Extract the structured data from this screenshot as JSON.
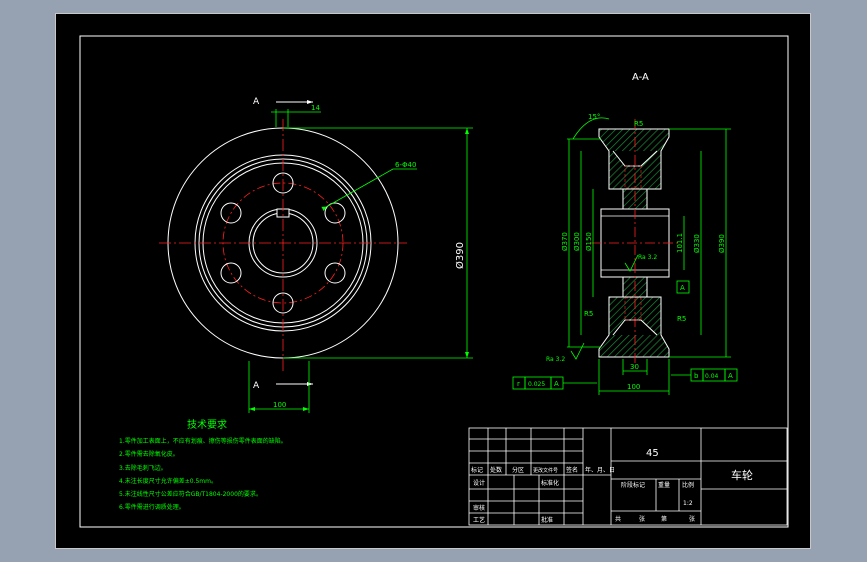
{
  "colors": {
    "background": "#96a1b1",
    "sheet": "#000000",
    "outline": "#ffffff",
    "dimension": "#00ff00",
    "centerline": "#ff2020",
    "hatch": "#1a8a3a"
  },
  "front_view": {
    "section_mark_top": "A",
    "section_mark_bottom": "A",
    "top_dim": "14",
    "hole_callout": "6-Φ40",
    "diameter_dim": "Ø390",
    "bottom_dim": "100"
  },
  "section_view": {
    "title": "A-A",
    "angle_dim": "15°",
    "chamfer_top": "R5",
    "chamfer_bottom": "R5",
    "dim_left_outer": "Ø370",
    "dim_left_mid": "Ø300",
    "dim_left_inner": "Ø150",
    "dim_bore": "101.1",
    "dim_right_mid": "Ø330",
    "dim_right_outer": "Ø390",
    "roughness_mid": "Ra 3.2",
    "roughness_low": "Ra 3.2",
    "datum_label": "A",
    "width_inner": "30",
    "width_total": "100",
    "runout_symbol": "r",
    "runout_value": "0.025",
    "runout_datum": "A",
    "perp_symbol": "b",
    "perp_value": "0.04",
    "perp_datum": "A"
  },
  "notes": {
    "title": "技术要求",
    "items": [
      "1.零件加工表面上，不应有划痕、擦伤等损伤零件表面的缺陷。",
      "2.零件需去除氧化皮。",
      "3.去除毛刺飞边。",
      "4.未注长度尺寸允许偏差±0.5mm。",
      "5.未注线性尺寸公差应符合GB/T1804-2000的要求。",
      "6.零件需进行调质处理。"
    ]
  },
  "title_block": {
    "material": "45",
    "part_name": "车轮",
    "hdr_mark": "标记",
    "hdr_count": "处数",
    "hdr_zone": "分区",
    "hdr_doc": "更改文件号",
    "hdr_sign": "签名",
    "hdr_date": "年、月、日",
    "design": "设计",
    "standard": "标准化",
    "stage": "阶段标记",
    "weight": "重量",
    "scale": "比例",
    "scale_value": "1:2",
    "review": "审核",
    "process": "工艺",
    "approve": "批准",
    "sheets_total": "共",
    "sheets_unit": "张",
    "sheet_no": "第",
    "sheet_unit2": "张"
  }
}
